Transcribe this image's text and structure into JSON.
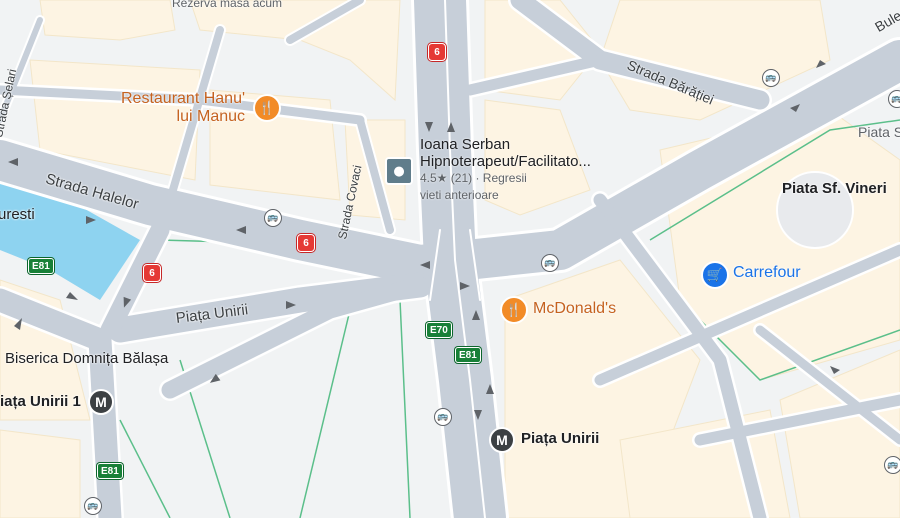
{
  "streets": {
    "strada_halelor": "Strada Halelor",
    "strada_baratiei": "Strada Bărăției",
    "strada_selari": "Strada Șelari",
    "strada_covaci": "Strada Covaci",
    "piata_unirii_road": "Piața Unirii",
    "bulevard_partial": "Bule"
  },
  "pois": {
    "hanu_manuc_line1": "Restaurant Hanu'",
    "hanu_manuc_line2": "lui Manuc",
    "mcdonalds": "McDonald's",
    "carrefour": "Carrefour",
    "ioana_line1": "Ioana Serban",
    "ioana_line2": "Hipnoterapeut/Facilitato...",
    "ioana_rating": "4.5★ (21) · Regresii",
    "ioana_line4": "vieti anterioare",
    "rezerva": "Rezerva masa acum"
  },
  "places": {
    "piata_sf_vineri": "Piata Sf. Vineri",
    "piata_s": "Piata S",
    "biserica": "Biserica Domnița Bălașa",
    "piata_unirii_1": "iața Unirii 1",
    "piata_unirii_metro": "Piața Unirii",
    "bucuresti_partial": "uresti"
  },
  "routes": {
    "dn6": "6",
    "e81": "E81",
    "e70": "E70"
  },
  "icons": {
    "metro_glyph": "M",
    "food_glyph": "🍴",
    "shop_glyph": "🛒",
    "bus_glyph": "🚌"
  },
  "colors": {
    "land": "#f1f3f4",
    "block": "#fdf4e3",
    "road": "#c7cfd9",
    "road_edge": "#ffffff",
    "water": "#8ed3f0",
    "park_line": "#5bbf8a"
  }
}
